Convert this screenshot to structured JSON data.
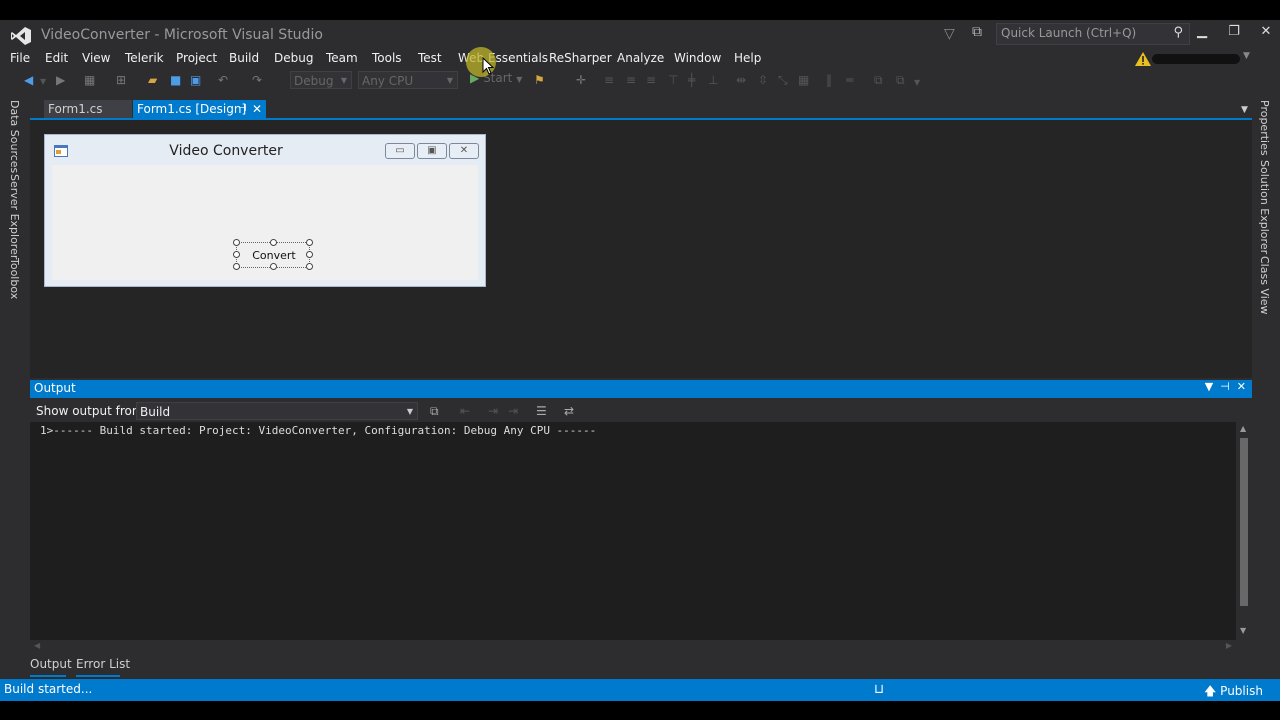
{
  "window": {
    "title": "VideoConverter - Microsoft Visual Studio",
    "quick_launch_placeholder": "Quick Launch (Ctrl+Q)"
  },
  "icons": [
    "vs-logo-icon",
    "filter-icon",
    "feedback-icon",
    "search-icon",
    "minimize-icon",
    "restore-icon",
    "close-icon",
    "warning-icon",
    "back-icon",
    "forward-icon",
    "save-icon",
    "save-all-icon",
    "open-icon",
    "undo-icon",
    "redo-icon",
    "start-play-icon",
    "attach-icon",
    "align-icon",
    "pin-icon",
    "clear-all-icon",
    "word-wrap-icon",
    "arrow-up-icon",
    "publish-icon",
    "form-icon"
  ],
  "menu": {
    "items": [
      "File",
      "Edit",
      "View",
      "Telerik",
      "Project",
      "Build",
      "Debug",
      "Team",
      "Tools",
      "Test",
      "Web Essentials",
      "ReSharper",
      "Analyze",
      "Window",
      "Help"
    ]
  },
  "toolbar": {
    "config": "Debug",
    "platform": "Any CPU",
    "start_label": "Start"
  },
  "left_sidebar": [
    "Data Sources",
    "Server Explorer",
    "Toolbox"
  ],
  "right_sidebar": [
    "Properties",
    "Solution Explorer",
    "Class View"
  ],
  "doc_tabs": [
    {
      "label": "Form1.cs",
      "active": false
    },
    {
      "label": "Form1.cs [Design]",
      "active": true
    }
  ],
  "designer": {
    "form_title": "Video Converter",
    "button_label": "Convert"
  },
  "output": {
    "title": "Output",
    "show_from_label": "Show output from:",
    "source": "Build",
    "lines": [
      "1>------ Build started: Project: VideoConverter, Configuration: Debug Any CPU ------"
    ]
  },
  "bottom_tabs": [
    "Output",
    "Error List"
  ],
  "status": {
    "text": "Build started...",
    "publish_label": "Publish"
  },
  "colors": {
    "accent": "#007acc",
    "background": "#2d2d30",
    "editor": "#1e1e1e",
    "warning": "#e8c020"
  }
}
